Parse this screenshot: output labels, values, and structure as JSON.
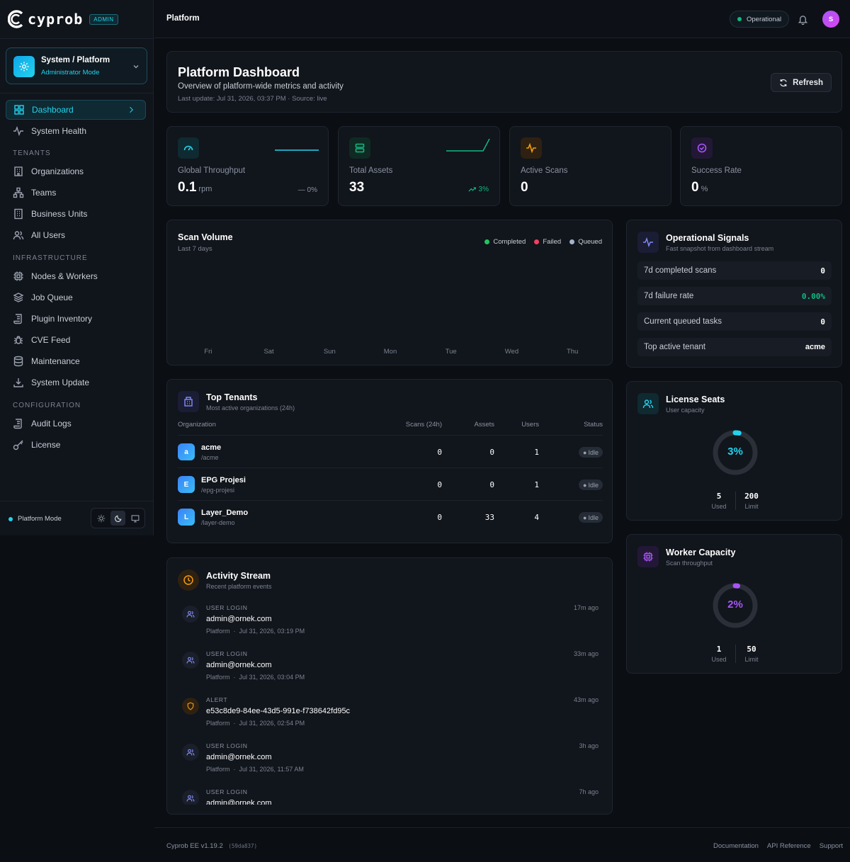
{
  "brand": {
    "name": "cyprob",
    "badge": "ADMIN"
  },
  "scope": {
    "title": "System / Platform",
    "subtitle": "Administrator Mode"
  },
  "nav": {
    "dashboard": "Dashboard",
    "health": "System Health",
    "tenants_section": "TENANTS",
    "organizations": "Organizations",
    "teams": "Teams",
    "business_units": "Business Units",
    "all_users": "All Users",
    "infra_section": "INFRASTRUCTURE",
    "nodes": "Nodes & Workers",
    "job_queue": "Job Queue",
    "plugin_inventory": "Plugin Inventory",
    "cve_feed": "CVE Feed",
    "maintenance": "Maintenance",
    "system_update": "System Update",
    "config_section": "CONFIGURATION",
    "audit_logs": "Audit Logs",
    "license": "License"
  },
  "mode": {
    "label": "Platform Mode"
  },
  "topbar": {
    "title": "Platform",
    "status": "Operational",
    "avatar": "S"
  },
  "header": {
    "title": "Platform Dashboard",
    "subtitle": "Overview of platform-wide metrics and activity",
    "meta": "Last update: Jul 31, 2026, 03:37 PM · Source: live",
    "refresh": "Refresh"
  },
  "stats": [
    {
      "label": "Global Throughput",
      "value": "0.1",
      "unit": "rpm",
      "trend": "— 0%"
    },
    {
      "label": "Total Assets",
      "value": "33",
      "unit": "",
      "trend": "3%"
    },
    {
      "label": "Active Scans",
      "value": "0",
      "unit": "",
      "trend": ""
    },
    {
      "label": "Success Rate",
      "value": "0",
      "unit": "%",
      "trend": ""
    }
  ],
  "scan_volume": {
    "title": "Scan Volume",
    "subtitle": "Last 7 days",
    "legend": [
      "Completed",
      "Failed",
      "Queued"
    ]
  },
  "chart_data": {
    "type": "bar",
    "categories": [
      "Fri",
      "Sat",
      "Sun",
      "Mon",
      "Tue",
      "Wed",
      "Thu"
    ],
    "series": [
      {
        "name": "Completed",
        "values": [
          0,
          0,
          0,
          0,
          0,
          0,
          0
        ]
      },
      {
        "name": "Failed",
        "values": [
          0,
          0,
          0,
          0,
          0,
          0,
          0
        ]
      },
      {
        "name": "Queued",
        "values": [
          0,
          0,
          0,
          0,
          0,
          0,
          0
        ]
      }
    ]
  },
  "signals": {
    "title": "Operational Signals",
    "subtitle": "Fast snapshot from dashboard stream",
    "rows": [
      {
        "label": "7d completed scans",
        "value": "0"
      },
      {
        "label": "7d failure rate",
        "value": "0.00%"
      },
      {
        "label": "Current queued tasks",
        "value": "0"
      },
      {
        "label": "Top active tenant",
        "value": "acme"
      }
    ]
  },
  "tenants": {
    "title": "Top Tenants",
    "subtitle": "Most active organizations (24h)",
    "columns": [
      "Organization",
      "Scans (24h)",
      "Assets",
      "Users",
      "Status"
    ],
    "rows": [
      {
        "initial": "a",
        "name": "acme",
        "slug": "/acme",
        "scans": "0",
        "assets": "0",
        "users": "1",
        "status": "Idle"
      },
      {
        "initial": "E",
        "name": "EPG Projesi",
        "slug": "/epg-projesi",
        "scans": "0",
        "assets": "0",
        "users": "1",
        "status": "Idle"
      },
      {
        "initial": "L",
        "name": "Layer_Demo",
        "slug": "/layer-demo",
        "scans": "0",
        "assets": "33",
        "users": "4",
        "status": "Idle"
      }
    ]
  },
  "license": {
    "title": "License Seats",
    "subtitle": "User capacity",
    "percent": "3%",
    "percent_value": 0.03,
    "used": "5",
    "used_label": "Used",
    "limit": "200",
    "limit_label": "Limit"
  },
  "worker": {
    "title": "Worker Capacity",
    "subtitle": "Scan throughput",
    "percent": "2%",
    "percent_value": 0.02,
    "used": "1",
    "used_label": "Used",
    "limit": "50",
    "limit_label": "Limit"
  },
  "activity": {
    "title": "Activity Stream",
    "subtitle": "Recent platform events",
    "items": [
      {
        "type": "USER LOGIN",
        "subject": "admin@ornek.com",
        "scope": "Platform",
        "time": "Jul 31, 2026, 03:19 PM",
        "ago": "17m ago"
      },
      {
        "type": "USER LOGIN",
        "subject": "admin@ornek.com",
        "scope": "Platform",
        "time": "Jul 31, 2026, 03:04 PM",
        "ago": "33m ago"
      },
      {
        "type": "ALERT",
        "subject": "e53c8de9-84ee-43d5-991e-f738642fd95c",
        "scope": "Platform",
        "time": "Jul 31, 2026, 02:54 PM",
        "ago": "43m ago"
      },
      {
        "type": "USER LOGIN",
        "subject": "admin@ornek.com",
        "scope": "Platform",
        "time": "Jul 31, 2026, 11:57 AM",
        "ago": "3h ago"
      },
      {
        "type": "USER LOGIN",
        "subject": "admin@ornek.com",
        "scope": "",
        "time": "",
        "ago": "7h ago"
      }
    ]
  },
  "footer": {
    "version": "Cyprob EE v1.19.2",
    "build": "(59da837)",
    "docs": "Documentation",
    "api": "API Reference",
    "support": "Support"
  },
  "colors": {
    "accent": "#22d3ee",
    "completed": "#22c55e",
    "failed": "#f43f5e",
    "queued": "#a5b4cb",
    "purple": "#a855f7"
  }
}
